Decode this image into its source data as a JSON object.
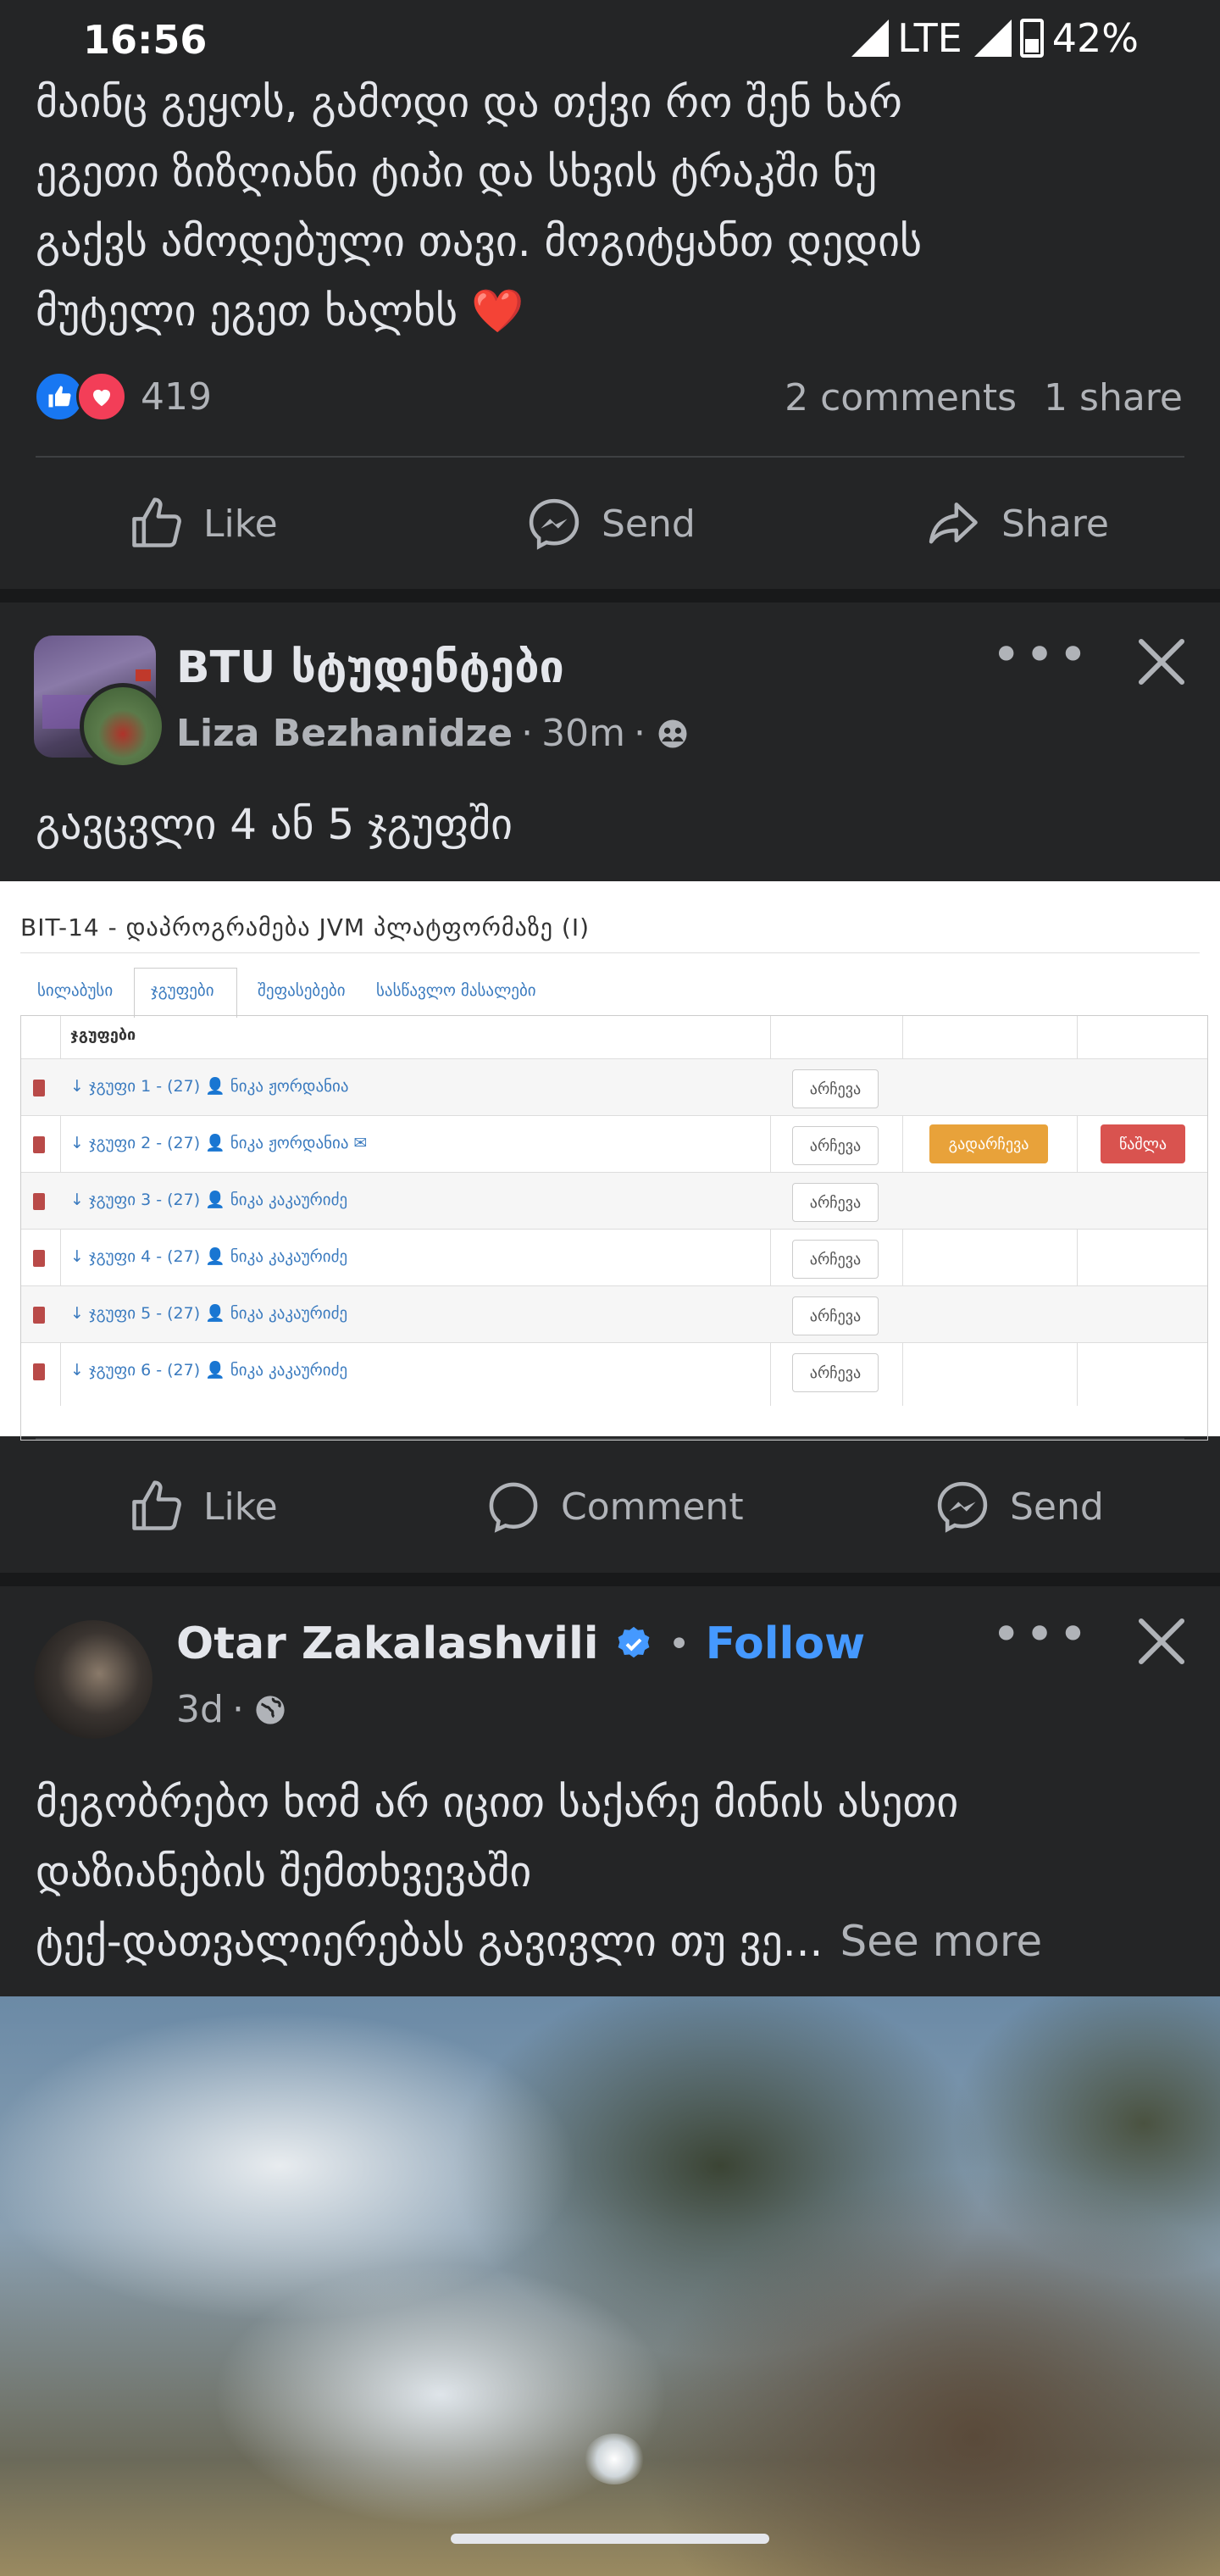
{
  "status_bar": {
    "time": "16:56",
    "network": "LTE",
    "battery": "42%"
  },
  "post1": {
    "text_lines": [
      "მაინც გეყოს, გამოდი და თქვი რო შენ ხარ",
      "ეგეთი ზიზღიანი ტიპი და სხვის ტრაკში ნუ",
      "გაქვს ამოდებული თავი. მოგიტყანთ დედის",
      "მუტელი ეგეთ ხალხს ❤️"
    ],
    "reaction_count": "419",
    "comments": "2 comments",
    "shares": "1 share",
    "actions": {
      "like": "Like",
      "send": "Send",
      "share": "Share"
    }
  },
  "post2": {
    "group_name": "BTU სტუდენტები",
    "author": "Liza Bezhanidze",
    "time": "30m",
    "text": "გავცვლი 4 ან 5 ჯგუფში",
    "screenshot": {
      "title": "BIT-14 - დაპროგრამება JVM პლატფორმაზე (I)",
      "tabs": [
        "სილაბუსი",
        "ჯგუფები",
        "შეფასებები",
        "სასწავლო მასალები"
      ],
      "header": "ჯგუფები",
      "rows": [
        {
          "group": "↓ ჯგუფი 1 - (27) 👤 ნიკა ჟორდანია",
          "button": "არჩევა"
        },
        {
          "group": "↓ ჯგუფი 2 - (27) 👤 ნიკა ჟორდანია ✉",
          "button": "არჩევა",
          "button2": "გადარჩევა",
          "button3": "წაშლა"
        },
        {
          "group": "↓ ჯგუფი 3 - (27) 👤 ნიკა კაკაურიძე",
          "button": "არჩევა"
        },
        {
          "group": "↓ ჯგუფი 4 - (27) 👤 ნიკა კაკაურიძე",
          "button": "არჩევა"
        },
        {
          "group": "↓ ჯგუფი 5 - (27) 👤 ნიკა კაკაურიძე",
          "button": "არჩევა"
        },
        {
          "group": "↓ ჯგუფი 6 - (27) 👤 ნიკა კაკაურიძე",
          "button": "არჩევა"
        }
      ]
    },
    "actions": {
      "like": "Like",
      "comment": "Comment",
      "send": "Send"
    }
  },
  "post3": {
    "author": "Otar Zakalashvili",
    "follow": "Follow",
    "time": "3d",
    "text_lines": [
      "მეგობრებო ხომ არ იცით საქარე მინის ასეთი",
      "დაზიანების შემთხვევაში",
      "ტექ-დათვალიერებას გავივლი თუ ვე..."
    ],
    "see_more": "See more"
  },
  "colors": {
    "background": "#242526",
    "separator": "#18191a",
    "accent_blue": "#4599ff",
    "text_secondary": "#b0b3b8"
  }
}
